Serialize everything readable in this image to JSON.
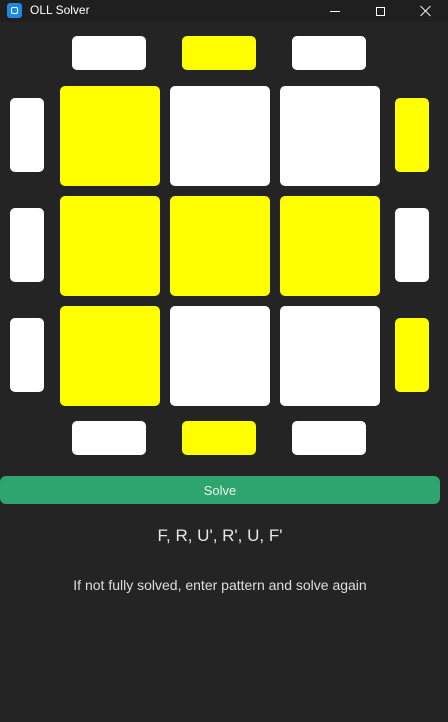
{
  "window": {
    "title": "OLL Solver",
    "icon": "app-icon",
    "controls": [
      "minimize-icon",
      "maximize-icon",
      "close-icon"
    ]
  },
  "colors": {
    "yellow": "#ffff00",
    "white": "#ffffff",
    "background": "#242424",
    "button": "#2ea56f"
  },
  "cube": {
    "top_edges": [
      "white",
      "yellow",
      "white"
    ],
    "bottom_edges": [
      "white",
      "yellow",
      "white"
    ],
    "left_edges": [
      "white",
      "white",
      "white"
    ],
    "right_edges": [
      "yellow",
      "white",
      "yellow"
    ],
    "face": [
      [
        "yellow",
        "white",
        "white"
      ],
      [
        "yellow",
        "yellow",
        "yellow"
      ],
      [
        "yellow",
        "white",
        "white"
      ]
    ]
  },
  "solve_button": {
    "label": "Solve"
  },
  "solution_text": "F, R, U', R', U, F'",
  "hint_text": "If not fully solved, enter pattern and solve again"
}
